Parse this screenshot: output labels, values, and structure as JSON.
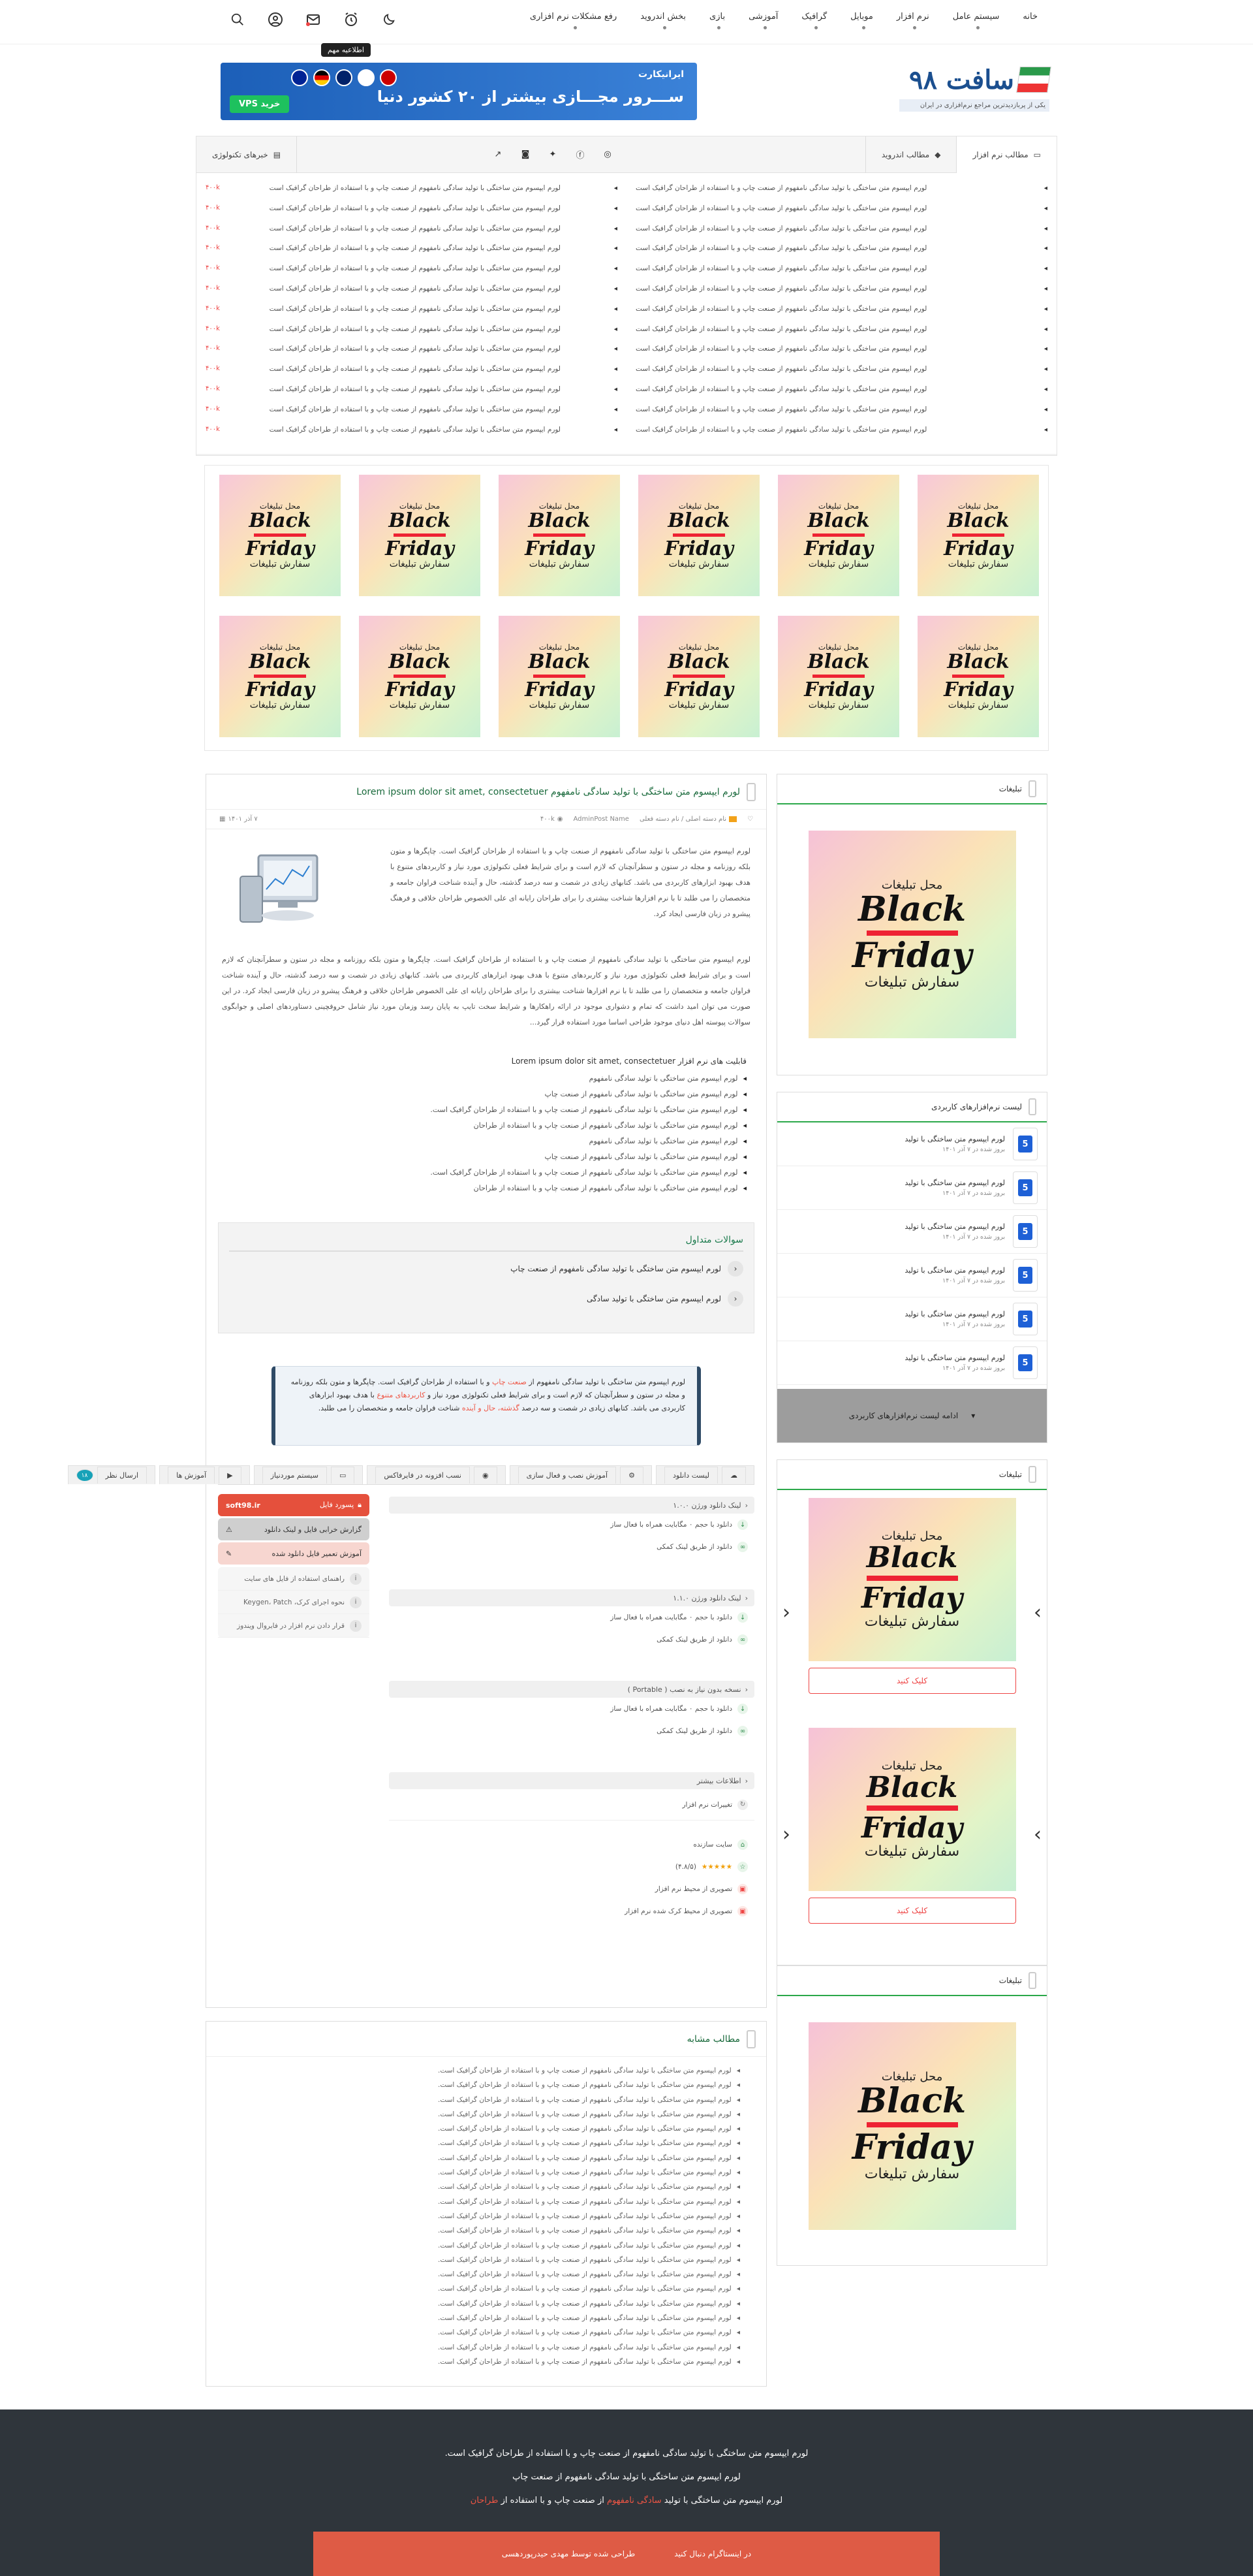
{
  "nav": {
    "items": [
      "خانه",
      "سیستم عامل",
      "نرم افزار",
      "موبایل",
      "گرافیک",
      "آموزشی",
      "بازی",
      "بخش اندروید",
      "رفع مشکلات نرم افزاری"
    ],
    "tooltip": "اطلاعیه مهم"
  },
  "logo": {
    "title": "سافت ۹۸",
    "subtitle": "یکی از پربازدیدترین مراجع نرم‌افزاری در ایران"
  },
  "banner": {
    "brand": "ایرانیکارت",
    "headline": "ســـرور مجـــازی بیشتر از ۲۰ کشور دنیا",
    "cta": "خرید VPS"
  },
  "tabs": {
    "software": "مطالب نرم افزار",
    "android": "مطالب اندروید",
    "tech": "خبرهای تکنولوژی"
  },
  "ticker": {
    "item_text": "لورم ایپسوم متن ساختگی با تولید سادگی نامفهوم از صنعت چاپ و با استفاده از طراحان گرافیک است",
    "views": "۴۰۰k"
  },
  "ad": {
    "top": "محل تبلیغات",
    "line1": "Black",
    "line2": "Friday",
    "bottom": "سفارش تبلیغات",
    "click": "کلیک کنید"
  },
  "article": {
    "title": "لورم ایپسوم متن ساختگی با تولید سادگی نامفهوم Lorem ipsum dolor sit amet, consectetuer",
    "date": "۷ آذر ۱۴۰۱",
    "views": "۴۰۰k",
    "author": "AdminPost Name",
    "category": "نام دسته اصلی / نام دسته فعلی",
    "p1": "لورم ایپسوم متن ساختگی با تولید سادگی نامفهوم از صنعت چاپ و با استفاده از طراحان گرافیک است. چاپگرها و متون بلکه روزنامه و مجله در ستون و سطرآنچنان که لازم است و برای شرایط فعلی تکنولوژی مورد نیاز و کاربردهای متنوع با هدف بهبود ابزارهای کاربردی می باشد. کتابهای زیادی در شصت و سه درصد گذشته، حال و آینده شناخت فراوان جامعه و متخصصان را می طلبد تا با نرم افزارها شناخت بیشتری را برای طراحان رایانه ای علی الخصوص طراحان خلاقی و فرهنگ پیشرو در زبان فارسی ایجاد کرد.",
    "p2": "لورم ایپسوم متن ساختگی با تولید سادگی نامفهوم از صنعت چاپ و با استفاده از طراحان گرافیک است. چاپگرها و متون بلکه روزنامه و مجله در ستون و سطرآنچنان که لازم است و برای شرایط فعلی تکنولوژی مورد نیاز و کاربردهای متنوع با هدف بهبود ابزارهای کاربردی می باشد. کتابهای زیادی در شصت و سه درصد گذشته، حال و آینده شناخت فراوان جامعه و متخصصان را می طلبد تا با نرم افزارها شناخت بیشتری را برای طراحان رایانه ای علی الخصوص طراحان خلاقی و فرهنگ پیشرو در زبان فارسی ایجاد کرد. در این صورت می توان امید داشت که تمام و دشواری موجود در ارائه راهکارها و شرایط سخت تایپ به پایان رسد وزمان مورد نیاز شامل حروفچینی دستاوردهای اصلی و جوابگوی سوالات پیوسته اهل دنیای موجود طراحی اساسا مورد استفاده قرار گیرد...",
    "features_title": "قابلیت های نرم افزار Lorem ipsum dolor sit amet, consectetuer",
    "features": [
      "لورم ایپسوم متن ساختگی با تولید سادگی نامفهوم",
      "لورم ایپسوم متن ساختگی با تولید سادگی نامفهوم از صنعت چاپ",
      "لورم ایپسوم متن ساختگی با تولید سادگی نامفهوم از صنعت چاپ و با استفاده از طراحان گرافیک است.",
      "لورم ایپسوم متن ساختگی با تولید سادگی نامفهوم از صنعت چاپ و با استفاده از طراحان",
      "لورم ایپسوم متن ساختگی با تولید سادگی نامفهوم",
      "لورم ایپسوم متن ساختگی با تولید سادگی نامفهوم از صنعت چاپ",
      "لورم ایپسوم متن ساختگی با تولید سادگی نامفهوم از صنعت چاپ و با استفاده از طراحان گرافیک است.",
      "لورم ایپسوم متن ساختگی با تولید سادگی نامفهوم از صنعت چاپ و با استفاده از طراحان"
    ]
  },
  "faq": {
    "title": "سوالات متداول",
    "q1": "لورم ایپسوم متن ساختگی با تولید سادگی نامفهوم از صنعت چاپ",
    "q2": "لورم ایپسوم متن ساختگی با تولید سادگی"
  },
  "notice": {
    "a": "لورم ایپسوم متن ساختگی با تولید سادگی نامفهوم از ",
    "b": "صنعت چاپ",
    "c": " و با استفاده از طراحان گرافیک است. چاپگرها و متون بلکه روزنامه و مجله در ستون و سطرآنچنان که لازم است و برای شرایط فعلی تکنولوژی مورد نیاز و ",
    "d": "کاربردهای متنوع",
    "e": " با هدف بهبود ابزارهای کاربردی می باشد. کتابهای زیادی در شصت و سه درصد ",
    "f": "گذشته، حال و آینده",
    "g": " شناخت فراوان جامعه و متخصصان را می طلبد."
  },
  "dltabs": [
    "لیست دانلود",
    "آموزش نصب و فعال سازی",
    "نسب افزونه در فایرفاکس",
    "سیستم موردنیاز",
    "آموزش ها",
    "ارسال نظر"
  ],
  "dltabs_count": "۱۸",
  "downloads": {
    "s1": "لینک دانلود ورژن ۱.۰.۰",
    "s2": "لینک دانلود ورژن ۱.۱.۰",
    "s3": "نسخه بدون نیاز به نصب ( Portable )",
    "s4": "اطلاعات بیشتر",
    "direct": "دانلود با حجم ۰ مگابایت همراه با فعال ساز",
    "torrent": "دانلود از طریق لینک کمکی",
    "changes": "تغییرات نرم افزار",
    "site": "سایت سازنده",
    "rating": "(۴.۸/۵)",
    "shot1": "تصویری از محیط نرم افزار",
    "shot2": "تصویری از محیط کرک شده نرم افزار"
  },
  "side_actions": {
    "pass_label": "پسورد فایل",
    "pass_value": "soft98.ir",
    "report": "گزارش خرابی فایل و لینک دانلود",
    "fix": "آموزش تعمیر فایل دانلود شده",
    "i1": "راهنمای استفاده از فایل های سایت",
    "i2": "نحوه اجرای کرک، Keygen، Patch",
    "i3": "قرار دادن نرم افزار در فایروال ویندوز"
  },
  "similar": {
    "title": "مطالب مشابه",
    "item": "لورم ایپسوم متن ساختگی با تولید سادگی نامفهوم از صنعت چاپ و با استفاده از طراحان گرافیک است."
  },
  "sidebar": {
    "ads_title": "تبلیغات",
    "list_title": "لیست نرم‌افزارهای کاربردی",
    "item_title": "لورم ایپسوم متن ساختگی با تولید",
    "item_date": "بروز شده در ۷ آذر ۱۴۰۱",
    "more": "ادامه لیست نرم‌افزارهای کاربردی"
  },
  "footer": {
    "l1": "لورم ایپسوم متن ساختگی با تولید سادگی نامفهوم از صنعت چاپ و با استفاده از طراحان گرافیک است.",
    "l2": "لورم ایپسوم متن ساختگی با تولید سادگی نامفهوم از صنعت چاپ",
    "l3a": "لورم ایپسوم متن ساختگی با تولید ",
    "l3b": "سادگی نامفهوم",
    "l3c": " از صنعت چاپ و با استفاده از ",
    "l3d": "طراحان",
    "bar_a": "طراحی شده توسط مهدی حیدرپوردهسی",
    "bar_b": "در اینستاگرام دنبال کنید"
  },
  "colors": {
    "accent_green": "#2ba84a",
    "accent_red": "#e5503c",
    "footer_bg": "#2f353b"
  }
}
